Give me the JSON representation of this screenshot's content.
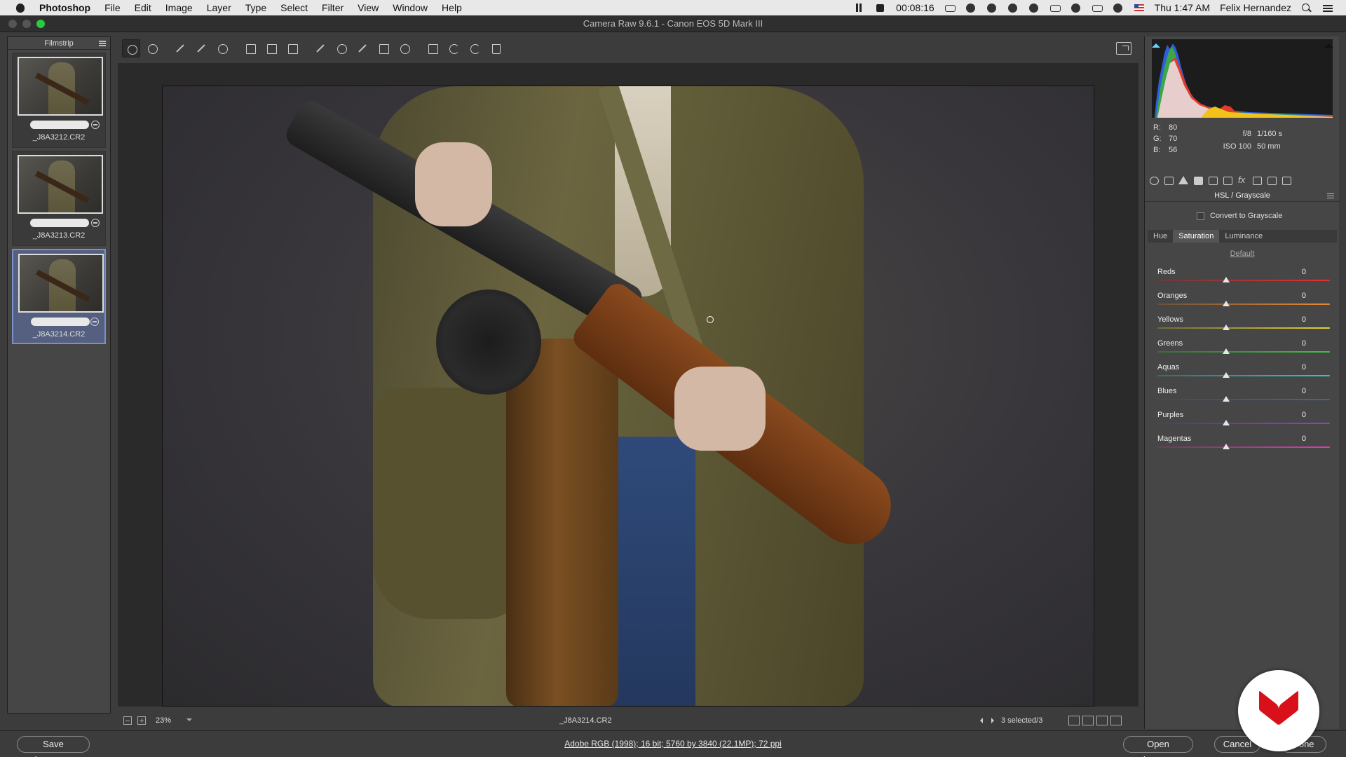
{
  "menubar": {
    "app_name": "Photoshop",
    "items": [
      "File",
      "Edit",
      "Image",
      "Layer",
      "Type",
      "Select",
      "Filter",
      "View",
      "Window",
      "Help"
    ],
    "timer": "00:08:16",
    "clock": "Thu 1:47 AM",
    "user": "Felix Hernandez"
  },
  "window": {
    "title": "Camera Raw 9.6.1  -  Canon EOS 5D Mark III"
  },
  "filmstrip": {
    "title": "Filmstrip",
    "items": [
      {
        "filename": "_J8A3212.CR2",
        "selected": false
      },
      {
        "filename": "_J8A3213.CR2",
        "selected": false
      },
      {
        "filename": "_J8A3214.CR2",
        "selected": true
      }
    ]
  },
  "toolbar": {
    "tools": [
      "zoom-icon",
      "hand-icon",
      "white-balance-icon",
      "color-sampler-icon",
      "targeted-adjustment-icon",
      "crop-icon",
      "straighten-icon",
      "transform-icon",
      "spot-removal-icon",
      "red-eye-icon",
      "adjustment-brush-icon",
      "graduated-filter-icon",
      "radial-filter-icon",
      "preferences-icon",
      "rotate-left-icon",
      "rotate-right-icon",
      "trash-icon"
    ]
  },
  "canvas": {
    "zoom": "23%",
    "filename": "_J8A3214.CR2",
    "selection": "3 selected/3"
  },
  "readout": {
    "r_label": "R:",
    "r_value": "80",
    "g_label": "G:",
    "g_value": "70",
    "b_label": "B:",
    "b_value": "56",
    "aperture": "f/8",
    "shutter": "1/160 s",
    "iso": "ISO 100",
    "focal": "50 mm"
  },
  "panel": {
    "title": "HSL / Grayscale",
    "grayscale_label": "Convert to Grayscale",
    "tabs": [
      "Hue",
      "Saturation",
      "Luminance"
    ],
    "active_tab": "Saturation",
    "default_label": "Default",
    "sliders": [
      {
        "label": "Reds",
        "value": "0",
        "colors": [
          "#6b3a3a",
          "#e33030"
        ]
      },
      {
        "label": "Oranges",
        "value": "0",
        "colors": [
          "#6b503a",
          "#e88a30"
        ]
      },
      {
        "label": "Yellows",
        "value": "0",
        "colors": [
          "#6b6b3a",
          "#e6d030"
        ]
      },
      {
        "label": "Greens",
        "value": "0",
        "colors": [
          "#3d6b3a",
          "#40c040"
        ]
      },
      {
        "label": "Aquas",
        "value": "0",
        "colors": [
          "#3a6b6b",
          "#30c8c8"
        ]
      },
      {
        "label": "Blues",
        "value": "0",
        "colors": [
          "#3a4a6b",
          "#3060e0"
        ]
      },
      {
        "label": "Purples",
        "value": "0",
        "colors": [
          "#553a6b",
          "#9040d8"
        ]
      },
      {
        "label": "Magentas",
        "value": "0",
        "colors": [
          "#6b3a60",
          "#d840b0"
        ]
      }
    ]
  },
  "bottombar": {
    "save_label": "Save Images...",
    "workflow_text": "Adobe RGB (1998); 16 bit; 5760 by 3840 (22.1MP); 72 ppi",
    "open_label": "Open Images",
    "cancel_label": "Cancel",
    "done_label": "Done"
  },
  "colors": {
    "selected_thumb": "#556080",
    "logo_red": "#d8101a"
  }
}
